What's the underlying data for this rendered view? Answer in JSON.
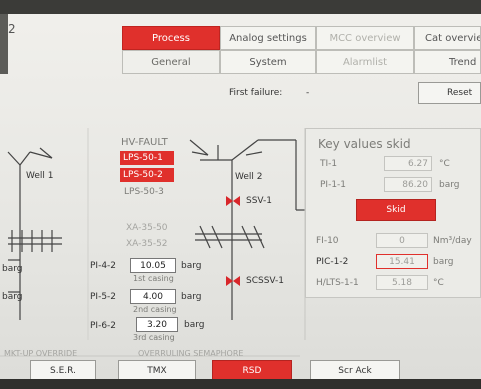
{
  "tabs_row1": [
    "Process",
    "Analog settings",
    "MCC overview",
    "Cat overview"
  ],
  "tabs_row2": [
    "General",
    "System",
    "Alarmlist",
    "Trend"
  ],
  "header": {
    "first_failure_label": "First failure:",
    "first_failure_value": "-",
    "reset_label": "Reset"
  },
  "well1": {
    "label": "Well 1",
    "left_value_1": "barg",
    "left_value_2": "barg"
  },
  "well2": {
    "label": "Well 2",
    "ssv_label": "SSV-1",
    "scssv_label": "SCSSV-1"
  },
  "hv_fault": {
    "title": "HV-FAULT",
    "items": [
      "LPS-50-1",
      "LPS-50-2",
      "LPS-50-3"
    ]
  },
  "xa": [
    "XA-35-50",
    "XA-35-52"
  ],
  "pressures": [
    {
      "tag": "PI-4-2",
      "value": "10.05",
      "unit": "barg",
      "desc": "1st casing"
    },
    {
      "tag": "PI-5-2",
      "value": "4.00",
      "unit": "barg",
      "desc": "2nd casing"
    },
    {
      "tag": "PI-6-2",
      "value": "3.20",
      "unit": "barg",
      "desc": "3rd casing"
    }
  ],
  "key_values": {
    "title": "Key values skid",
    "rows": [
      {
        "tag": "TI-1",
        "value": "6.27",
        "unit": "°C"
      },
      {
        "tag": "PI-1-1",
        "value": "86.20",
        "unit": "barg"
      }
    ],
    "skid_label": "Skid",
    "lower_rows": [
      {
        "tag": "FI-10",
        "value": "0",
        "unit": "Nm³/day"
      },
      {
        "tag": "PIC-1-2",
        "value": "15.41",
        "unit": "barg"
      },
      {
        "tag": "H/LTS-1-1",
        "value": "5.18",
        "unit": "°C"
      }
    ]
  },
  "bottom": {
    "override_label": "MKT-UP OVERRIDE",
    "semaphore_label": "OVERRULING SEMAPHORE",
    "buttons": [
      "S.E.R.",
      "TMX",
      "RSD",
      "Scr Ack"
    ]
  },
  "colors": {
    "accent_red": "#e0302c",
    "panel_bg": "#ebebe7"
  },
  "corner_glyph": "2"
}
